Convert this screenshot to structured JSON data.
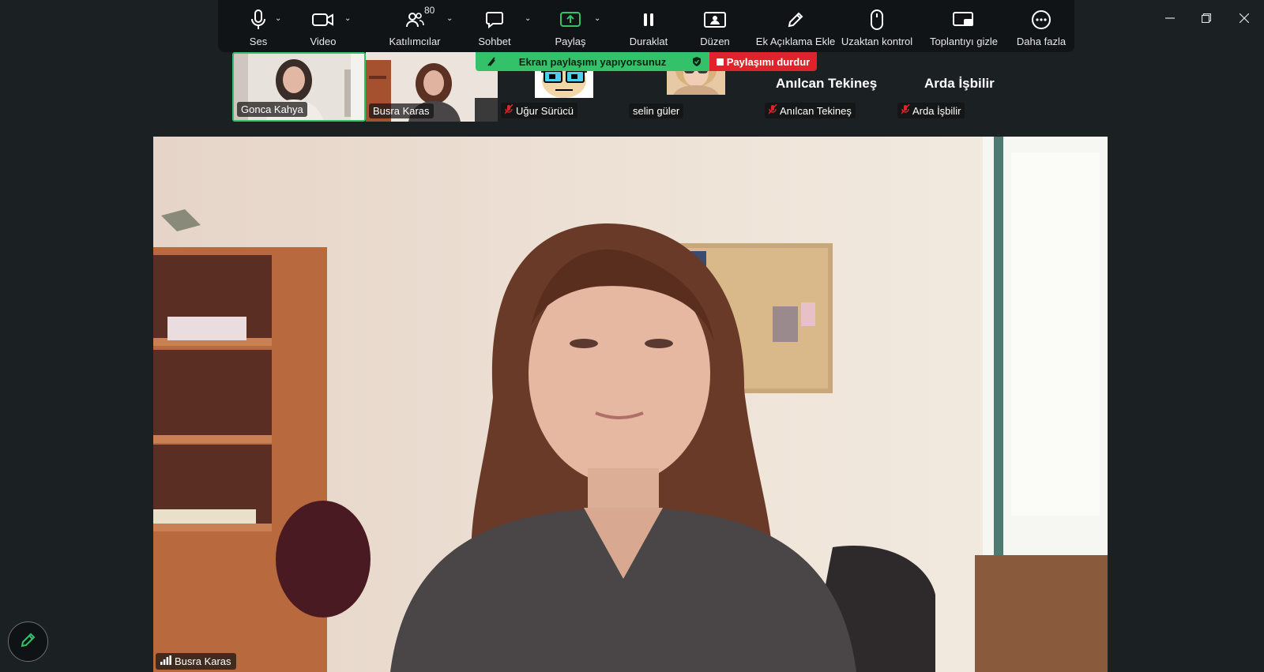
{
  "toolbar": {
    "items": [
      {
        "label": "Ses",
        "icon": "microphone-icon"
      },
      {
        "label": "Video",
        "icon": "video-camera-icon"
      },
      {
        "label": "Katılımcılar",
        "icon": "participants-icon",
        "count": "80"
      },
      {
        "label": "Sohbet",
        "icon": "chat-icon"
      },
      {
        "label": "Paylaş",
        "icon": "share-screen-icon"
      },
      {
        "label": "Duraklat",
        "icon": "pause-icon"
      },
      {
        "label": "Düzen",
        "icon": "layout-icon"
      },
      {
        "label": "Ek Açıklama Ekle",
        "icon": "annotate-pen-icon"
      },
      {
        "label": "Uzaktan kontrol",
        "icon": "mouse-icon"
      },
      {
        "label": "Toplantıyı gizle",
        "icon": "hide-meeting-icon"
      },
      {
        "label": "Daha fazla",
        "icon": "more-icon"
      }
    ]
  },
  "share_banner": {
    "text": "Ekran paylaşımı yapıyorsunuz",
    "stop_label": "Paylaşımı durdur",
    "color": "#33c26a",
    "stop_color": "#e0232b"
  },
  "participants": [
    {
      "name": "Gonca Kahya",
      "active_speaker": true
    },
    {
      "name": "Busra Karas"
    },
    {
      "name": "Uğur Sürücü",
      "muted": true
    },
    {
      "name": "selin güler"
    },
    {
      "name": "Anılcan Tekineş",
      "muted": true,
      "display_name": "Anılcan Tekineş"
    },
    {
      "name": "Arda İşbilir",
      "muted": true,
      "display_name": "Arda İşbilir"
    }
  ],
  "main_video": {
    "speaker_name": "Busra Karas"
  },
  "colors": {
    "accent_green": "#33c26a",
    "background": "#1b2023",
    "toolbar": "#101416"
  }
}
